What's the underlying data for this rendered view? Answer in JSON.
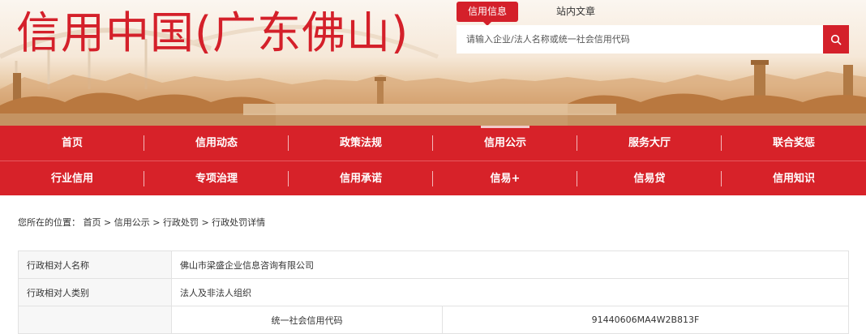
{
  "header": {
    "site_title": "信用中国(广东佛山)",
    "search_tabs": [
      {
        "label": "信用信息",
        "active": true
      },
      {
        "label": "站内文章",
        "active": false
      }
    ],
    "search_placeholder": "请输入企业/法人名称或统一社会信用代码",
    "search_icon": "search-icon"
  },
  "nav": {
    "row1": [
      {
        "label": "首页"
      },
      {
        "label": "信用动态"
      },
      {
        "label": "政策法规"
      },
      {
        "label": "信用公示",
        "current": true
      },
      {
        "label": "服务大厅"
      },
      {
        "label": "联合奖惩"
      }
    ],
    "row2": [
      {
        "label": "行业信用"
      },
      {
        "label": "专项治理"
      },
      {
        "label": "信用承诺"
      },
      {
        "label": "信易+"
      },
      {
        "label": "信易贷"
      },
      {
        "label": "信用知识"
      }
    ]
  },
  "breadcrumb": {
    "prefix": "您所在的位置：",
    "items": [
      "首页",
      "信用公示",
      "行政处罚",
      "行政处罚详情"
    ],
    "separator": " > "
  },
  "details": {
    "rows": [
      {
        "label": "行政相对人名称",
        "value": "佛山市梁盛企业信息咨询有限公司"
      },
      {
        "label": "行政相对人类别",
        "value": "法人及非法人组织"
      }
    ],
    "code_row": {
      "label": "统一社会信用代码",
      "value": "91440606MA4W2B813F"
    }
  },
  "colors": {
    "brand_red": "#d72229",
    "title_red": "#d4202a"
  }
}
